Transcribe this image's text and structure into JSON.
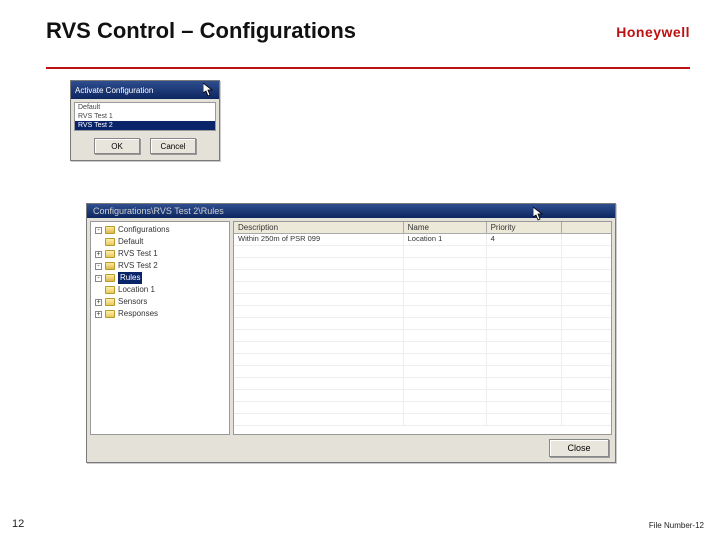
{
  "slide": {
    "title": "RVS Control – Configurations",
    "brand": "Honeywell",
    "pageNumber": "12",
    "fileNumberPrefix": "File Number-",
    "fileNumberValue": "12"
  },
  "activateDialog": {
    "title": "Activate Configuration",
    "items": [
      "Default",
      "RVS Test 1",
      "RVS Test 2"
    ],
    "selectedIndex": 2,
    "okLabel": "OK",
    "cancelLabel": "Cancel"
  },
  "rulesWindow": {
    "title": "Configurations\\RVS Test 2\\Rules",
    "tree": [
      {
        "depth": 0,
        "toggle": "-",
        "open": true,
        "label": "Configurations",
        "selected": false
      },
      {
        "depth": 1,
        "toggle": "",
        "open": false,
        "label": "Default",
        "selected": false
      },
      {
        "depth": 1,
        "toggle": "+",
        "open": false,
        "label": "RVS Test 1",
        "selected": false
      },
      {
        "depth": 1,
        "toggle": "-",
        "open": true,
        "label": "RVS Test 2",
        "selected": false
      },
      {
        "depth": 2,
        "toggle": "-",
        "open": true,
        "label": "Rules",
        "selected": true
      },
      {
        "depth": 3,
        "toggle": "",
        "open": false,
        "label": "Location 1",
        "selected": false
      },
      {
        "depth": 2,
        "toggle": "+",
        "open": false,
        "label": "Sensors",
        "selected": false
      },
      {
        "depth": 2,
        "toggle": "+",
        "open": false,
        "label": "Responses",
        "selected": false
      }
    ],
    "columns": {
      "description": "Description",
      "name": "Name",
      "priority": "Priority"
    },
    "rows": [
      {
        "description": "Within 250m of PSR 099",
        "name": "Location 1",
        "priority": "4"
      }
    ],
    "emptyRowCount": 15,
    "closeLabel": "Close"
  }
}
